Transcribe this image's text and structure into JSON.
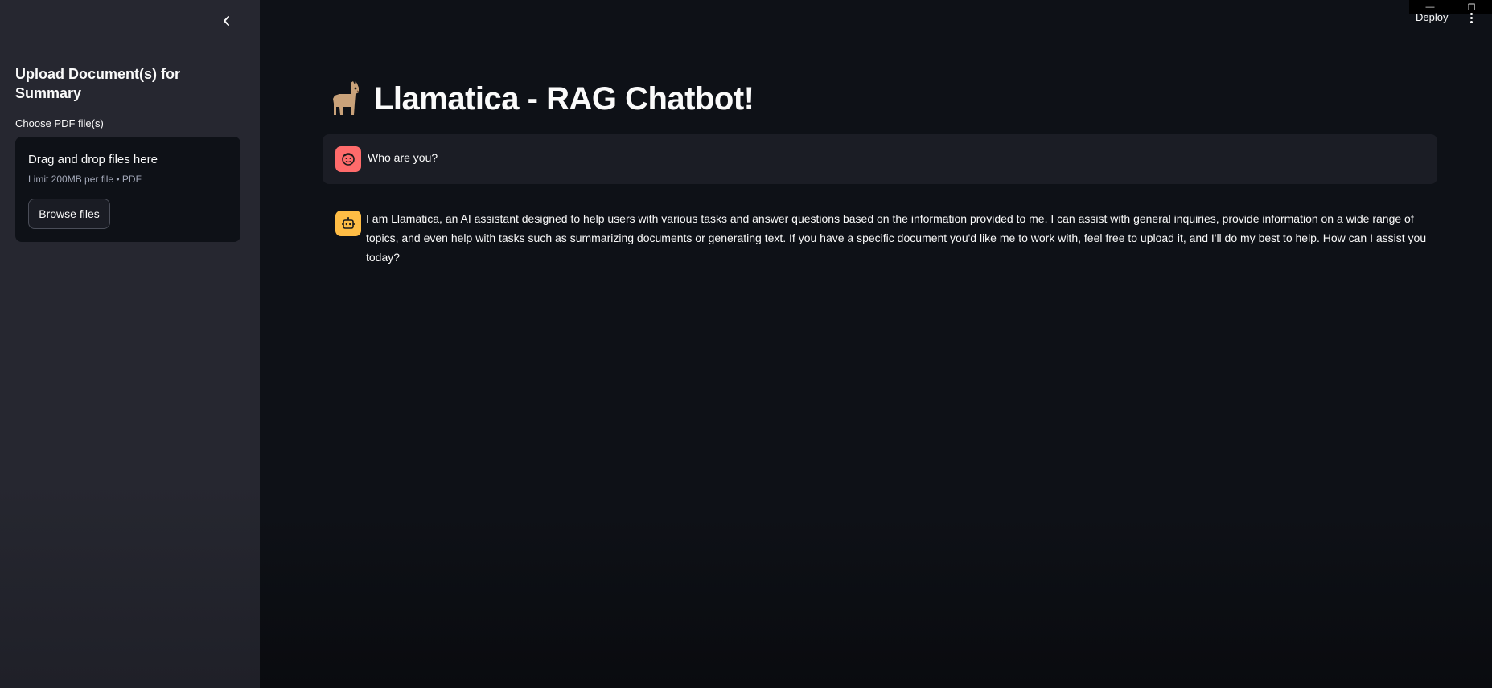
{
  "sidebar": {
    "title": "Upload Document(s) for Summary",
    "uploader": {
      "label": "Choose PDF file(s)",
      "drop_title": "Drag and drop files here",
      "limit_text": "Limit 200MB per file • PDF",
      "browse_label": "Browse files"
    }
  },
  "header": {
    "deploy_label": "Deploy"
  },
  "main": {
    "title": "Llamatica - RAG Chatbot!",
    "title_icon": "llama-icon"
  },
  "chat": {
    "messages": [
      {
        "role": "user",
        "avatar_icon": "user-face-icon",
        "text": "Who are you?"
      },
      {
        "role": "assistant",
        "avatar_icon": "robot-icon",
        "text": "I am Llamatica, an AI assistant designed to help users with various tasks and answer questions based on the information provided to me. I can assist with general inquiries, provide information on a wide range of topics, and even help with tasks such as summarizing documents or generating text. If you have a specific document you'd like me to work with, feel free to upload it, and I'll do my best to help. How can I assist you today?"
      }
    ]
  },
  "colors": {
    "sidebar_bg": "#262730",
    "main_bg": "#0e1117",
    "user_avatar": "#ff6b6b",
    "bot_avatar": "#ffbd45"
  }
}
